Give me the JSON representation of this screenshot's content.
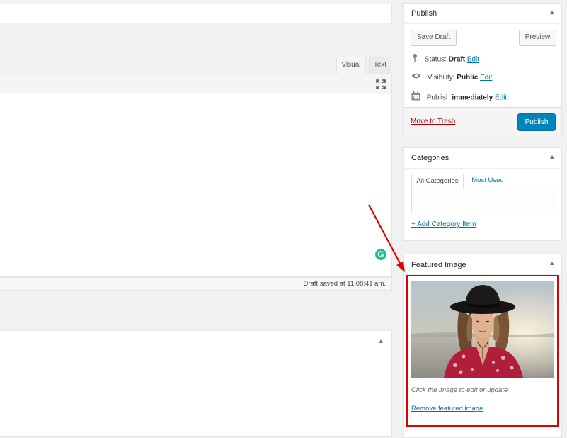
{
  "editor": {
    "tabs": [
      {
        "label": "Visual"
      },
      {
        "label": "Text"
      }
    ],
    "draft_status": "Draft saved at 11:08:41 am."
  },
  "publish": {
    "title": "Publish",
    "save_draft_label": "Save Draft",
    "preview_label": "Preview",
    "status_label": "Status:",
    "status_value": "Draft",
    "visibility_label": "Visibility:",
    "visibility_value": "Public",
    "publish_label": "Publish",
    "publish_value": "immediately",
    "edit_label": "Edit",
    "trash_label": "Move to Trash",
    "publish_button_label": "Publish"
  },
  "categories": {
    "title": "Categories",
    "tabs": [
      {
        "label": "All Categories"
      },
      {
        "label": "Most Used"
      }
    ],
    "add_link": "+ Add Category Item"
  },
  "featured_image": {
    "title": "Featured Image",
    "hint": "Click the image to edit or update",
    "remove_link": "Remove featured image"
  },
  "colors": {
    "accent": "#0085ba",
    "link": "#0073aa",
    "trash": "#a00",
    "annotation": "#e00000",
    "grammarly": "#15c39a"
  }
}
